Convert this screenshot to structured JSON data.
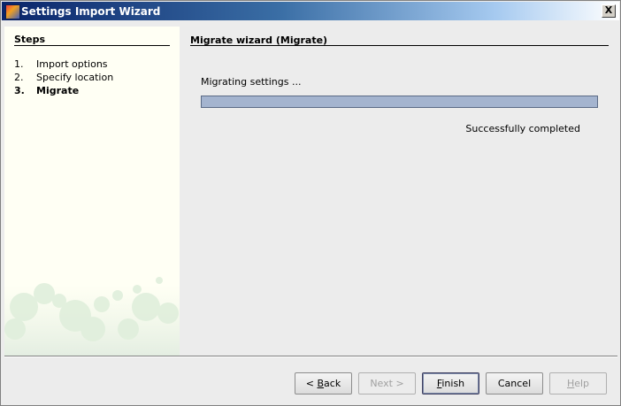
{
  "window": {
    "title": "Settings Import Wizard",
    "close_label": "X"
  },
  "steps": {
    "title": "Steps",
    "items": [
      {
        "num": "1.",
        "label": "Import options",
        "current": false
      },
      {
        "num": "2.",
        "label": "Specify location",
        "current": false
      },
      {
        "num": "3.",
        "label": "Migrate",
        "current": true
      }
    ]
  },
  "main": {
    "title": "Migrate wizard (Migrate)",
    "status": "Migrating settings ...",
    "progress_fraction": 1.0,
    "completion": "Successfully completed"
  },
  "buttons": {
    "back": {
      "label_pre": "< ",
      "mnemonic": "B",
      "label_post": "ack"
    },
    "next": {
      "label": "Next >"
    },
    "finish": {
      "mnemonic": "F",
      "label_post": "inish"
    },
    "cancel": {
      "label": "Cancel"
    },
    "help": {
      "mnemonic": "H",
      "label_post": "elp"
    }
  },
  "icons": {
    "app": "app-icon",
    "close": "close-icon"
  }
}
